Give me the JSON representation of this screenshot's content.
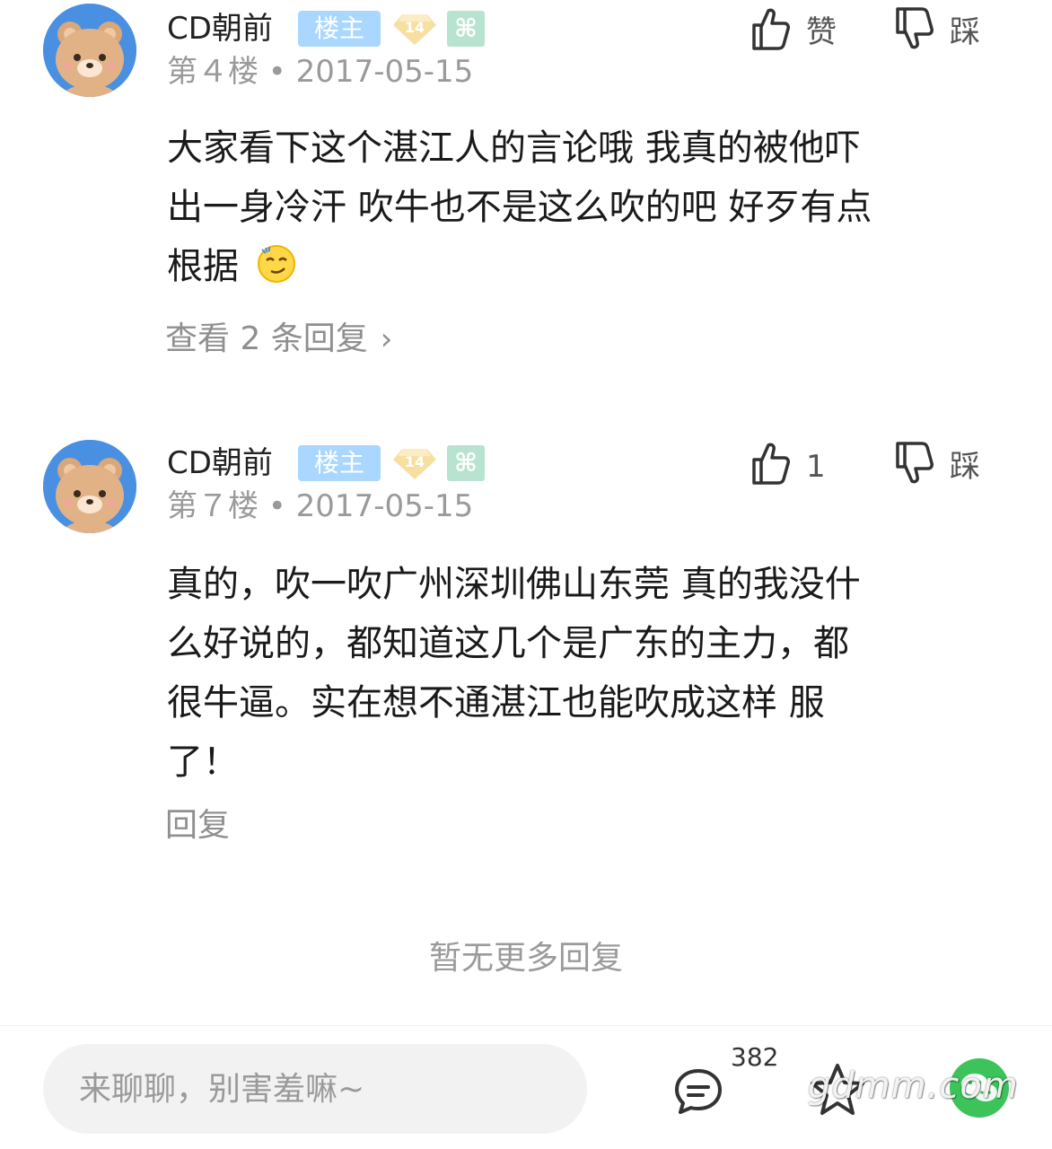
{
  "posts": [
    {
      "author": "CD朝前",
      "host_tag": "楼主",
      "level": "14",
      "floor_date": "第４楼 • 2017-05-15",
      "like_label": "赞",
      "dislike_label": "踩",
      "content_lines": [
        "大家看下这个湛江人的言论哦 我真的被他吓",
        "出一身冷汗 吹牛也不是这么吹的吧 好歹有点",
        "根据"
      ],
      "replies_link": "查看 2 条回复"
    },
    {
      "author": "CD朝前",
      "host_tag": "楼主",
      "level": "14",
      "floor_date": "第７楼 • 2017-05-15",
      "like_label": "1",
      "dislike_label": "踩",
      "content_lines": [
        "真的，吹一吹广州深圳佛山东莞 真的我没什",
        "么好说的，都知道这几个是广东的主力，都",
        "很牛逼。实在想不通湛江也能吹成这样 服",
        "了！"
      ],
      "reply_link": "回复"
    }
  ],
  "no_more_text": "暂无更多回复",
  "bottom_bar": {
    "input_placeholder": "来聊聊，别害羞嘛~",
    "comment_count": "382",
    "watermark": "gdmm.com"
  },
  "colors": {
    "host_tag_bg": "#a9d7ff",
    "level_badge": "#f6dfa0",
    "badge2_bg": "#b9e3d1",
    "avatar_bg": "#4a90e2",
    "wechat_green": "#3cc35a"
  },
  "icons": [
    "avatar-bear-icon",
    "level-diamond-icon",
    "thumbs-up-icon",
    "thumbs-down-icon",
    "smirk-emoji-icon",
    "chevron-right-icon",
    "comment-icon",
    "star-icon",
    "wechat-icon"
  ]
}
